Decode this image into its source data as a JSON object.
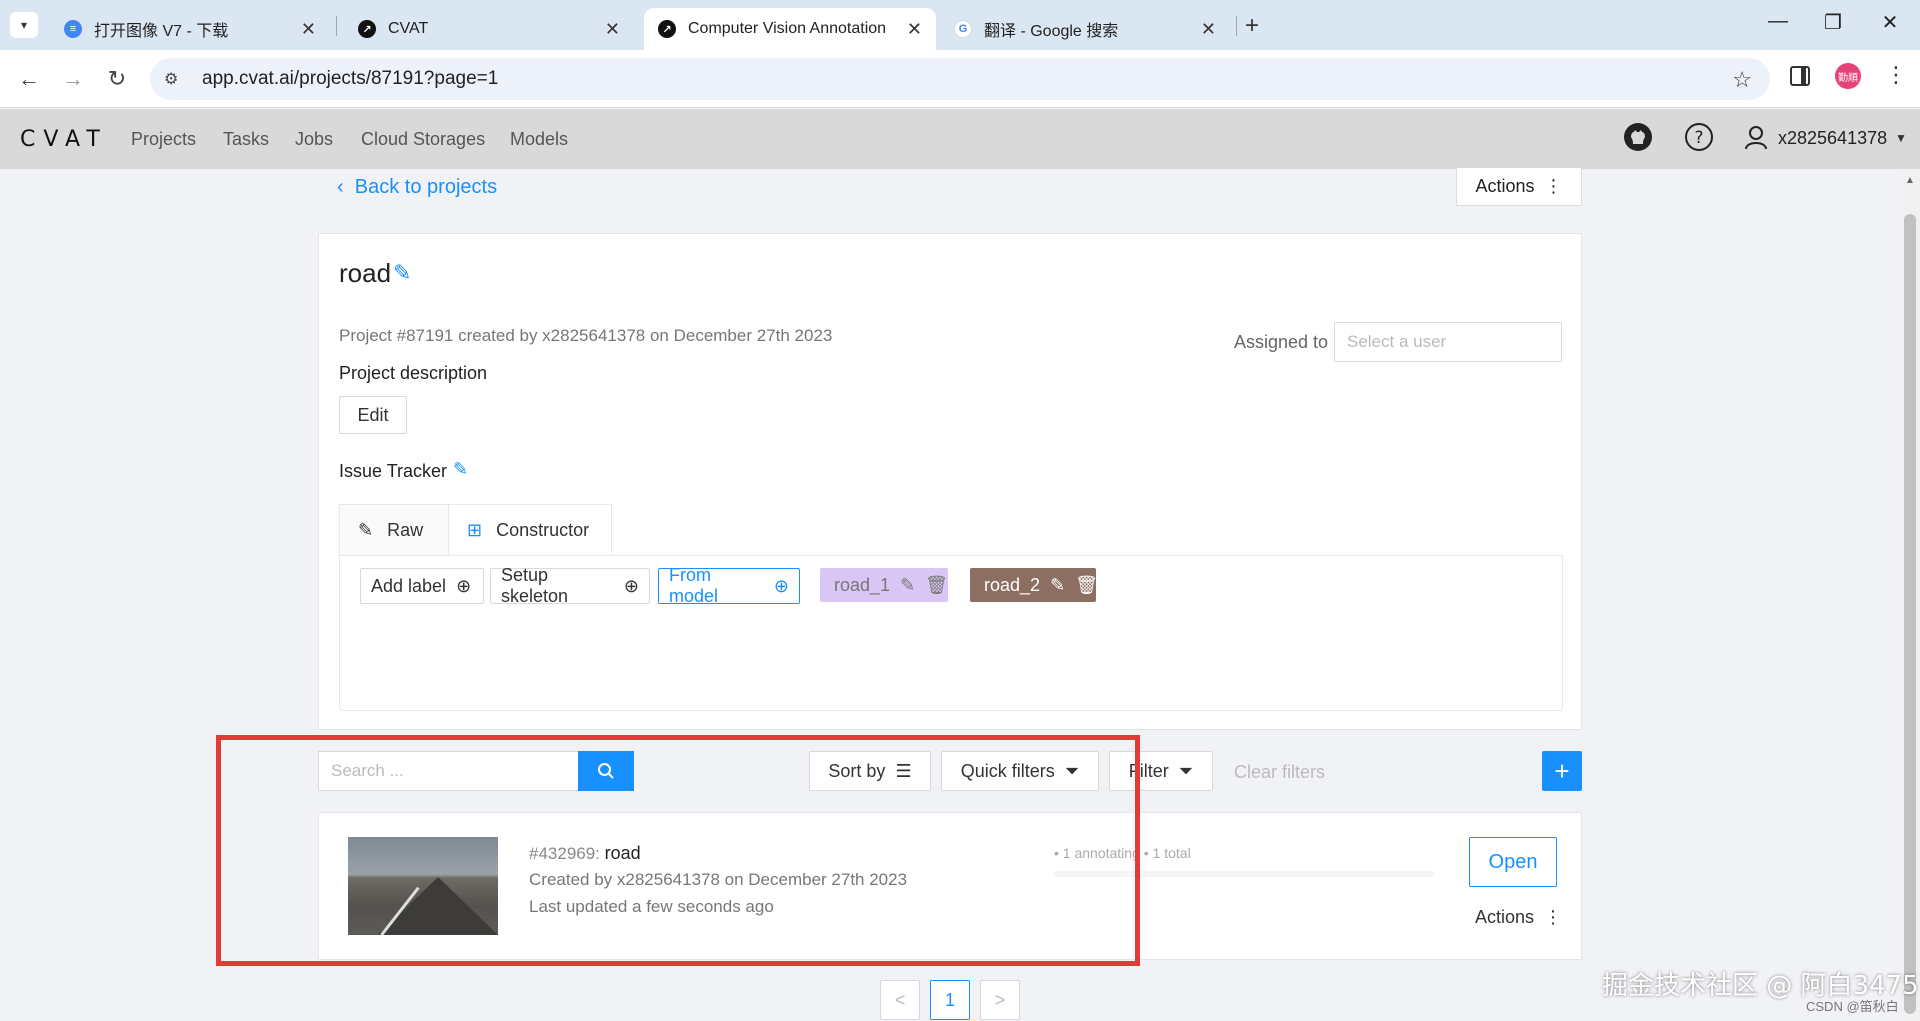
{
  "browser": {
    "tabs": [
      {
        "title": "打开图像 V7 - 下载",
        "icon": "doc-icon",
        "color": "#4285f4"
      },
      {
        "title": "CVAT",
        "icon": "cvat-icon",
        "color": "#111111"
      },
      {
        "title": "Computer Vision Annotation",
        "icon": "cvat-icon",
        "color": "#111111"
      },
      {
        "title": "翻译 - Google 搜索",
        "icon": "google-icon",
        "color": "#4285f4"
      }
    ],
    "url": "app.cvat.ai/projects/87191?page=1",
    "profile_initials": "勤順"
  },
  "header": {
    "logo": "CVAT",
    "nav": [
      "Projects",
      "Tasks",
      "Jobs",
      "Cloud Storages",
      "Models"
    ],
    "username": "x2825641378"
  },
  "project": {
    "back_label": "Back to projects",
    "actions_label": "Actions",
    "name": "road",
    "meta": "Project #87191 created by x2825641378 on December 27th 2023",
    "assigned_label": "Assigned to",
    "assigned_placeholder": "Select a user",
    "description_label": "Project description",
    "edit_label": "Edit",
    "issue_tracker_label": "Issue Tracker",
    "tabs": [
      "Raw",
      "Constructor"
    ],
    "label_buttons": [
      "Add label",
      "Setup skeleton",
      "From model"
    ],
    "labels": [
      {
        "name": "road_1",
        "color": "#d9c6f5"
      },
      {
        "name": "road_2",
        "color": "#8d6e63"
      }
    ]
  },
  "toolbar": {
    "search_placeholder": "Search ...",
    "sort_label": "Sort by",
    "quick_filters_label": "Quick filters",
    "filter_label": "Filter",
    "clear_filters_label": "Clear filters",
    "add_label": "+"
  },
  "task": {
    "id": "#432969: ",
    "name": "road",
    "created": "Created by x2825641378 on December 27th 2023",
    "updated": "Last updated a few seconds ago",
    "progress_text": "• 1 annotating • 1 total",
    "progress_fraction": 0,
    "open_label": "Open",
    "actions_label": "Actions"
  },
  "pagination": {
    "prev": "<",
    "current": "1",
    "next": ">"
  },
  "watermark": {
    "main": "掘金技术社区 @ 阿白3475",
    "sub": "CSDN @笛秋白"
  }
}
